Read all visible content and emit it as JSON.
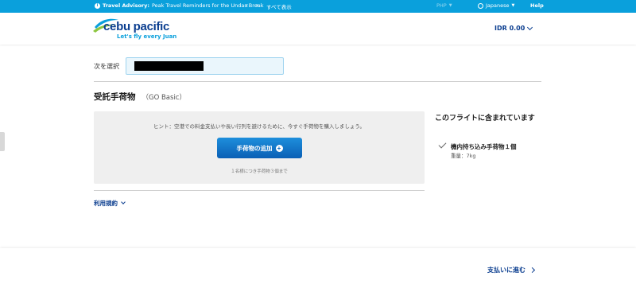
{
  "topbar": {
    "advisory_label": "Travel Advisory:",
    "advisory_text": "Peak Travel Reminders for the Undas Break",
    "show_all": "すべて表示",
    "currency": "PHP",
    "language": "Japanese",
    "help": "Help",
    "icons": [
      "info-icon",
      "chevron-left-icon",
      "chevron-right-icon",
      "globe-icon"
    ]
  },
  "header": {
    "brand": "cebu pacific",
    "tagline": "Let's fly every Juan",
    "fare_total": "IDR 0.00"
  },
  "select": {
    "label": "次を選択"
  },
  "baggage": {
    "title": "受託手荷物",
    "bundle": "（GO Basic）",
    "hint": "ヒント：空港での料金支払いや長い行列を避けるために、今すぐ手荷物を購入しましょう。",
    "add_button": "手荷物の追加",
    "limit": "１名様につき手荷物３個まで",
    "terms": "利用規約"
  },
  "included": {
    "title": "このフライトに含まれています",
    "item": "機内持ち込み手荷物１個",
    "weight": "重量：7kg"
  },
  "footer": {
    "continue": "支払いに進む"
  },
  "colors": {
    "topbar": "#0aa0dc",
    "brand_navy": "#0a3d8f",
    "button": "#0a6bc2"
  }
}
